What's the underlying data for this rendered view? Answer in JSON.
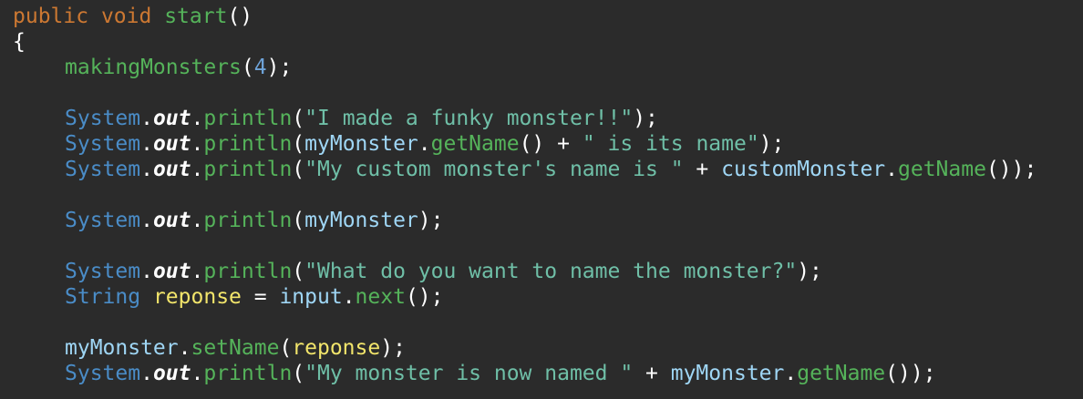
{
  "code": {
    "language": "java",
    "lines": [
      [
        {
          "t": "public",
          "c": "kw"
        },
        {
          "t": " ",
          "c": "pun"
        },
        {
          "t": "void",
          "c": "kw"
        },
        {
          "t": " ",
          "c": "pun"
        },
        {
          "t": "start",
          "c": "fn"
        },
        {
          "t": "()",
          "c": "pun"
        }
      ],
      [
        {
          "t": "{",
          "c": "pun"
        }
      ],
      [
        {
          "t": "makingMonsters",
          "c": "fn",
          "indent": true
        },
        {
          "t": "(",
          "c": "pun"
        },
        {
          "t": "4",
          "c": "num"
        },
        {
          "t": ");",
          "c": "pun"
        }
      ],
      [],
      [
        {
          "t": "System",
          "c": "cls",
          "indent": true
        },
        {
          "t": ".",
          "c": "pun"
        },
        {
          "t": "out",
          "c": "fld"
        },
        {
          "t": ".",
          "c": "pun"
        },
        {
          "t": "println",
          "c": "fn"
        },
        {
          "t": "(",
          "c": "pun"
        },
        {
          "t": "\"I made a funky monster!!\"",
          "c": "str"
        },
        {
          "t": ");",
          "c": "pun"
        }
      ],
      [
        {
          "t": "System",
          "c": "cls",
          "indent": true
        },
        {
          "t": ".",
          "c": "pun"
        },
        {
          "t": "out",
          "c": "fld"
        },
        {
          "t": ".",
          "c": "pun"
        },
        {
          "t": "println",
          "c": "fn"
        },
        {
          "t": "(",
          "c": "pun"
        },
        {
          "t": "myMonster",
          "c": "var"
        },
        {
          "t": ".",
          "c": "pun"
        },
        {
          "t": "getName",
          "c": "fn"
        },
        {
          "t": "() + ",
          "c": "pun"
        },
        {
          "t": "\" is its name\"",
          "c": "str"
        },
        {
          "t": ");",
          "c": "pun"
        }
      ],
      [
        {
          "t": "System",
          "c": "cls",
          "indent": true
        },
        {
          "t": ".",
          "c": "pun"
        },
        {
          "t": "out",
          "c": "fld"
        },
        {
          "t": ".",
          "c": "pun"
        },
        {
          "t": "println",
          "c": "fn"
        },
        {
          "t": "(",
          "c": "pun"
        },
        {
          "t": "\"My custom monster's name is \"",
          "c": "str"
        },
        {
          "t": " + ",
          "c": "pun"
        },
        {
          "t": "customMonster",
          "c": "var"
        },
        {
          "t": ".",
          "c": "pun"
        },
        {
          "t": "getName",
          "c": "fn"
        },
        {
          "t": "());",
          "c": "pun"
        }
      ],
      [],
      [
        {
          "t": "System",
          "c": "cls",
          "indent": true
        },
        {
          "t": ".",
          "c": "pun"
        },
        {
          "t": "out",
          "c": "fld"
        },
        {
          "t": ".",
          "c": "pun"
        },
        {
          "t": "println",
          "c": "fn"
        },
        {
          "t": "(",
          "c": "pun"
        },
        {
          "t": "myMonster",
          "c": "var"
        },
        {
          "t": ");",
          "c": "pun"
        }
      ],
      [],
      [
        {
          "t": "System",
          "c": "cls",
          "indent": true
        },
        {
          "t": ".",
          "c": "pun"
        },
        {
          "t": "out",
          "c": "fld"
        },
        {
          "t": ".",
          "c": "pun"
        },
        {
          "t": "println",
          "c": "fn"
        },
        {
          "t": "(",
          "c": "pun"
        },
        {
          "t": "\"What do you want to name the monster?\"",
          "c": "str"
        },
        {
          "t": ");",
          "c": "pun"
        }
      ],
      [
        {
          "t": "String",
          "c": "cls",
          "indent": true
        },
        {
          "t": " ",
          "c": "pun"
        },
        {
          "t": "reponse",
          "c": "lvar"
        },
        {
          "t": " = ",
          "c": "pun"
        },
        {
          "t": "input",
          "c": "var"
        },
        {
          "t": ".",
          "c": "pun"
        },
        {
          "t": "next",
          "c": "fn"
        },
        {
          "t": "();",
          "c": "pun"
        }
      ],
      [],
      [
        {
          "t": "myMonster",
          "c": "var",
          "indent": true
        },
        {
          "t": ".",
          "c": "pun"
        },
        {
          "t": "setName",
          "c": "fn"
        },
        {
          "t": "(",
          "c": "pun"
        },
        {
          "t": "reponse",
          "c": "lvar"
        },
        {
          "t": ");",
          "c": "pun"
        }
      ],
      [
        {
          "t": "System",
          "c": "cls",
          "indent": true
        },
        {
          "t": ".",
          "c": "pun"
        },
        {
          "t": "out",
          "c": "fld"
        },
        {
          "t": ".",
          "c": "pun"
        },
        {
          "t": "println",
          "c": "fn"
        },
        {
          "t": "(",
          "c": "pun"
        },
        {
          "t": "\"My monster is now named \"",
          "c": "str"
        },
        {
          "t": " + ",
          "c": "pun"
        },
        {
          "t": "myMonster",
          "c": "var"
        },
        {
          "t": ".",
          "c": "pun"
        },
        {
          "t": "getName",
          "c": "fn"
        },
        {
          "t": "());",
          "c": "pun"
        }
      ]
    ]
  },
  "theme": {
    "background": "#2b2b2b",
    "keyword": "#cc7832",
    "method": "#55b35a",
    "class": "#4a8cc7",
    "string": "#6fbfa7",
    "variable": "#9fd6f5",
    "local_variable": "#f2e56b",
    "punctuation": "#ffffff"
  }
}
